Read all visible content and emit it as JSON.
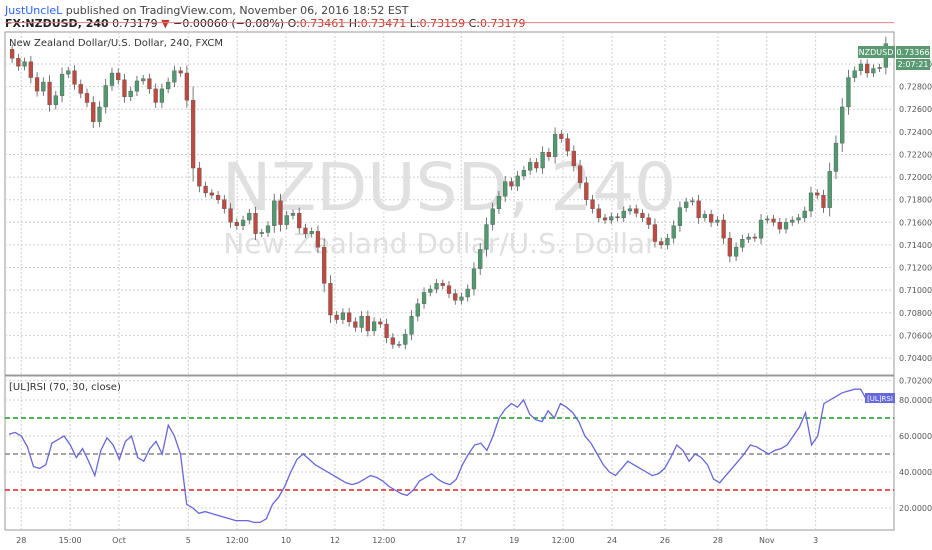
{
  "header": {
    "user": "JustUncleL",
    "published": "published on TradingView.com, November 06, 2016 18:52 EST",
    "symbol": "FX:NZDUSD, 240",
    "last": "0.73179",
    "down_arrow": "▼",
    "change": "−0.00060 (−0.08%)",
    "open_label": "O:",
    "open": "0.73461",
    "high_label": "H:",
    "high": "0.73471",
    "low_label": "L:",
    "low": "0.73159",
    "close_label": "C:",
    "close": "0.73179"
  },
  "pane_title": "New Zealand Dollar/U.S. Dollar, 240, FXCM",
  "watermark": {
    "symbol": "NZDUSD, 240",
    "name": "New Zealand Dollar/U.S. Dollar"
  },
  "badges": {
    "symbol": "NZDUSD",
    "price": "0.73366",
    "countdown": "2:07:21",
    "rsi": "[UL]RSI"
  },
  "rsi_title": "[UL]RSI (70, 30, close)",
  "colors": {
    "up": "#4f9a6e",
    "down": "#c2493f",
    "rsi_line": "#6666dd",
    "ob": "#1a9a1a",
    "mid": "#888888",
    "os": "#e02020",
    "price_line": "#e08080",
    "grid": "#cfcfcf"
  },
  "chart_data": [
    {
      "type": "candlestick",
      "title": "New Zealand Dollar/U.S. Dollar, 240, FXCM",
      "ylim": [
        0.702,
        0.735
      ],
      "y_ticks": [
        "0.73000",
        "0.72800",
        "0.72600",
        "0.72400",
        "0.72200",
        "0.72000",
        "0.71800",
        "0.71600",
        "0.71400",
        "0.71200",
        "0.71000",
        "0.70800",
        "0.70600",
        "0.70400",
        "0.70200"
      ],
      "x_ticks": [
        "28",
        "15:00",
        "Oct",
        "5",
        "12:00",
        "10",
        "12",
        "12:00",
        "17",
        "19",
        "12:00",
        "24",
        "26",
        "28",
        "Nov",
        "3"
      ],
      "current_price": 0.73366,
      "close_path": [
        0.7305,
        0.7298,
        0.7302,
        0.7288,
        0.7276,
        0.7284,
        0.7264,
        0.7272,
        0.7291,
        0.7294,
        0.7282,
        0.7274,
        0.7266,
        0.7249,
        0.7262,
        0.7281,
        0.7292,
        0.7286,
        0.7271,
        0.7276,
        0.7285,
        0.7287,
        0.7278,
        0.7266,
        0.7278,
        0.7284,
        0.7294,
        0.7292,
        0.7268,
        0.7208,
        0.7192,
        0.7186,
        0.7184,
        0.718,
        0.7172,
        0.716,
        0.7157,
        0.7162,
        0.7168,
        0.715,
        0.7151,
        0.7157,
        0.7179,
        0.7158,
        0.7166,
        0.7168,
        0.7155,
        0.715,
        0.7152,
        0.7138,
        0.7106,
        0.7078,
        0.7074,
        0.708,
        0.7072,
        0.7067,
        0.7077,
        0.7064,
        0.7072,
        0.707,
        0.7058,
        0.7052,
        0.7052,
        0.7061,
        0.7077,
        0.7088,
        0.7098,
        0.7101,
        0.7106,
        0.7104,
        0.7097,
        0.7091,
        0.7094,
        0.7101,
        0.7119,
        0.7136,
        0.7158,
        0.7172,
        0.7183,
        0.7196,
        0.7192,
        0.7201,
        0.7206,
        0.7213,
        0.7208,
        0.7222,
        0.7218,
        0.7238,
        0.7234,
        0.7223,
        0.721,
        0.7195,
        0.718,
        0.7172,
        0.7164,
        0.7162,
        0.7165,
        0.7164,
        0.717,
        0.7172,
        0.7168,
        0.7164,
        0.7158,
        0.7143,
        0.714,
        0.7146,
        0.7157,
        0.7173,
        0.7178,
        0.7179,
        0.7164,
        0.7167,
        0.716,
        0.7162,
        0.7146,
        0.713,
        0.7138,
        0.7145,
        0.7147,
        0.7146,
        0.7162,
        0.7163,
        0.716,
        0.7154,
        0.716,
        0.7162,
        0.7164,
        0.717,
        0.7186,
        0.7184,
        0.7173,
        0.7205,
        0.723,
        0.7262,
        0.7288,
        0.7294,
        0.73,
        0.7292,
        0.7296,
        0.7297,
        0.7318
      ]
    },
    {
      "type": "line",
      "title": "[UL]RSI (70, 30, close)",
      "ylim": [
        10,
        90
      ],
      "y_ticks": [
        "80.0000",
        "60.0000",
        "40.0000",
        "20.0000"
      ],
      "levels": {
        "overbought": 70,
        "mid": 50,
        "oversold": 30
      },
      "values": [
        61,
        62,
        60,
        54,
        43,
        42,
        44,
        56,
        58,
        60,
        55,
        48,
        53,
        46,
        38,
        52,
        59,
        55,
        47,
        57,
        60,
        48,
        46,
        53,
        57,
        50,
        66,
        60,
        50,
        22,
        20,
        17,
        18,
        17,
        16,
        15,
        14,
        13,
        13,
        13,
        12,
        12,
        14,
        22,
        26,
        32,
        40,
        47,
        50,
        47,
        44,
        42,
        40,
        38,
        36,
        34,
        33,
        34,
        36,
        38,
        37,
        35,
        32,
        30,
        28,
        27,
        30,
        35,
        37,
        39,
        36,
        34,
        33,
        36,
        44,
        50,
        55,
        56,
        52,
        60,
        70,
        75,
        78,
        76,
        80,
        72,
        69,
        68,
        74,
        70,
        78,
        76,
        73,
        68,
        60,
        56,
        50,
        44,
        40,
        38,
        42,
        46,
        44,
        42,
        40,
        38,
        39,
        42,
        48,
        55,
        52,
        46,
        50,
        48,
        44,
        36,
        34,
        38,
        42,
        46,
        50,
        55,
        54,
        52,
        50,
        52,
        53,
        55,
        60,
        65,
        73,
        55,
        60,
        78,
        80,
        82,
        84,
        85,
        86,
        86,
        80,
        79,
        80
      ]
    }
  ]
}
